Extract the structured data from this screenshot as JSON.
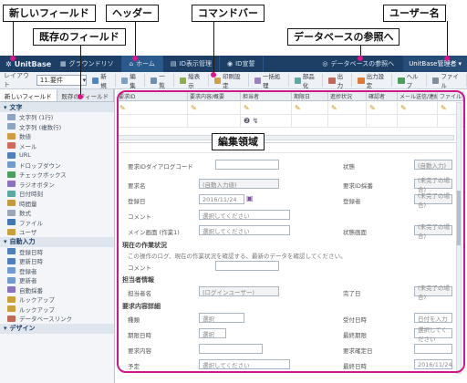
{
  "callouts": {
    "new_field": "新しいフィールド",
    "header": "ヘッダー",
    "command_bar": "コマンドバー",
    "user_name": "ユーザー名",
    "existing_field": "既存のフィールド",
    "db_reference": "データベースの参照へ",
    "edit_area": "編集領域"
  },
  "header": {
    "app_name": "UnitBase",
    "nav": [
      {
        "label": "グラウンドリソ"
      },
      {
        "label": "ホーム"
      },
      {
        "label": "ID表示管理"
      },
      {
        "label": "ID宣誓"
      }
    ],
    "db_ref": "データベースの参照へ",
    "user": "UnitBase管理者"
  },
  "commandbar": {
    "layout_label": "レイアウト",
    "layout_value": "11.要件",
    "items": [
      "新規",
      "編集",
      "一覧",
      "縦表示",
      "印刷設定",
      "一括処理",
      "部品化",
      "出力",
      "出力設定",
      "ヘルプ",
      "ファイル"
    ]
  },
  "leftpanel": {
    "tabs": [
      "新しいフィールド",
      "既存のフィールド"
    ],
    "groups": [
      {
        "label": "文字",
        "items": [
          "文字列 (1行)",
          "文字列 (複数行)",
          "数値",
          "メール",
          "URL",
          "ドロップダウン",
          "チェックボックス",
          "ラジオボタン",
          "日付時刻",
          "時間量",
          "数式",
          "ファイル",
          "ユーザ"
        ]
      },
      {
        "label": "自動入力",
        "items": [
          "登録日時",
          "更新日時",
          "登録者",
          "更新者",
          "自動採番",
          "ルックアップ",
          "ルックアップ",
          "データベースリンク"
        ]
      },
      {
        "label": "デザイン",
        "items": []
      }
    ]
  },
  "grid": {
    "columns": [
      "要求ID",
      "要求内容/概要",
      "担当者",
      "期限日",
      "進捗状況",
      "確認者",
      "メール送信/連絡",
      "ファイル"
    ]
  },
  "form": {
    "rows": [
      {
        "label": "要求IDダイアログコード",
        "value": ""
      },
      {
        "label": "要求名",
        "value": "(自動入力値)"
      },
      {
        "label": "登録日",
        "value": "2016/11/24"
      },
      {
        "label": "コメント",
        "value": "選択してください"
      },
      {
        "label": "メイン画面 (作業1)",
        "value": "選択してください"
      }
    ],
    "right": [
      {
        "label": "状態",
        "value": "(自動入力)"
      },
      {
        "label": "要求ID採番",
        "value": "(未完了の場合)"
      },
      {
        "label": "登録者",
        "value": "(未完了の場合)"
      },
      {
        "label": "状態画面",
        "value": "(未完了の場合)"
      }
    ],
    "section1": "現在の作業状況",
    "section1_note": "この操作のログ、現在の作業状況を確認する、最新のデータを確認してください。",
    "section1_row": "コメント",
    "section2": "担当者情報",
    "section2_label": "担当者名",
    "section2_value": "(ログインユーザー)",
    "section2_right_label": "完了日",
    "section2_right_value": "(未完了の場合)",
    "section3": "要求内容詳細",
    "r1": {
      "label": "種類",
      "value": "選択",
      "right_label": "受付日時",
      "right_value": "日付を入力"
    },
    "r2": {
      "label": "期限日時",
      "value": "選択",
      "right_label": "最終期限",
      "right_value": "選択してください"
    },
    "r3": {
      "label": "要求内容",
      "value": "",
      "right_label": "要求確定日",
      "right_value": ""
    },
    "r4": {
      "label": "予定",
      "value": "選択してください",
      "right_label": "最終日時",
      "right_value": "2016/11/24"
    }
  }
}
